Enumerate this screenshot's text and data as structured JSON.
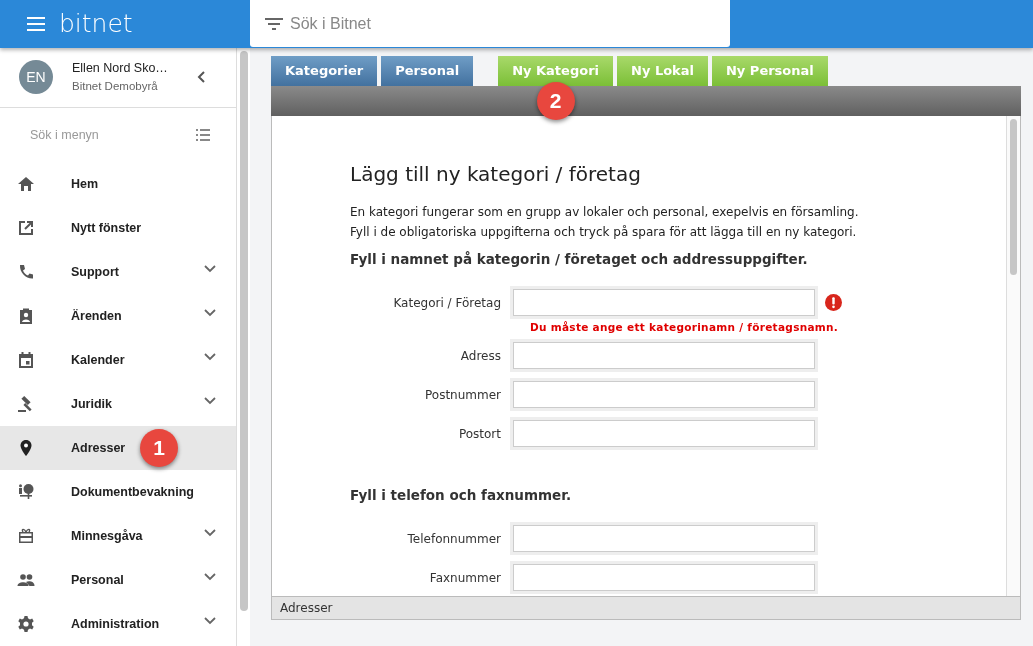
{
  "app": {
    "title": "bitnet",
    "search": {
      "placeholder": "Sök i Bitnet"
    }
  },
  "user": {
    "initials": "EN",
    "name": "Ellen Nord Sko…",
    "company": "Bitnet Demobyrå"
  },
  "sidebar": {
    "search": {
      "placeholder": "Sök i menyn"
    },
    "items": [
      {
        "kind": "home",
        "label": "Hem",
        "expandable": false,
        "selected": false
      },
      {
        "kind": "external",
        "label": "Nytt fönster",
        "expandable": false,
        "selected": false
      },
      {
        "kind": "phone",
        "label": "Support",
        "expandable": true,
        "selected": false
      },
      {
        "kind": "clipboard",
        "label": "Ärenden",
        "expandable": true,
        "selected": false
      },
      {
        "kind": "calendar",
        "label": "Kalender",
        "expandable": true,
        "selected": false
      },
      {
        "kind": "gavel",
        "label": "Juridik",
        "expandable": true,
        "selected": false
      },
      {
        "kind": "pin",
        "label": "Adresser",
        "expandable": false,
        "selected": true,
        "callout": "1"
      },
      {
        "kind": "tree",
        "label": "Dokumentbevakning",
        "expandable": false,
        "selected": false
      },
      {
        "kind": "gift",
        "label": "Minnesgåva",
        "expandable": true,
        "selected": false
      },
      {
        "kind": "people",
        "label": "Personal",
        "expandable": true,
        "selected": false
      },
      {
        "kind": "gear",
        "label": "Administration",
        "expandable": true,
        "selected": false
      }
    ]
  },
  "tab_groups": [
    {
      "kind": "list",
      "tabs": [
        {
          "label": "Kategorier"
        },
        {
          "label": "Personal"
        }
      ]
    },
    {
      "kind": "new",
      "tabs": [
        {
          "label": "Ny Kategori",
          "callout": "2"
        },
        {
          "label": "Ny Lokal"
        },
        {
          "label": "Ny Personal"
        }
      ]
    }
  ],
  "form": {
    "title": "Lägg till ny kategori / företag",
    "intro": [
      "En kategori fungerar som en grupp av lokaler och personal, exepelvis en församling.",
      "Fyll i de obligatoriska uppgifterna och tryck på spara för att lägga till en ny kategori."
    ],
    "sections": [
      {
        "heading": "Fyll i namnet på kategorin / företaget och addressuppgifter.",
        "fields": [
          {
            "label": "Kategori / Företag",
            "error": "Du måste ange ett kategorinamn / företagsnamn."
          },
          {
            "label": "Adress"
          },
          {
            "label": "Postnummer"
          },
          {
            "label": "Postort"
          }
        ]
      },
      {
        "heading": "Fyll i telefon och faxnummer.",
        "fields": [
          {
            "label": "Telefonnummer"
          },
          {
            "label": "Faxnummer"
          }
        ]
      }
    ]
  },
  "status_bar": "Adresser"
}
